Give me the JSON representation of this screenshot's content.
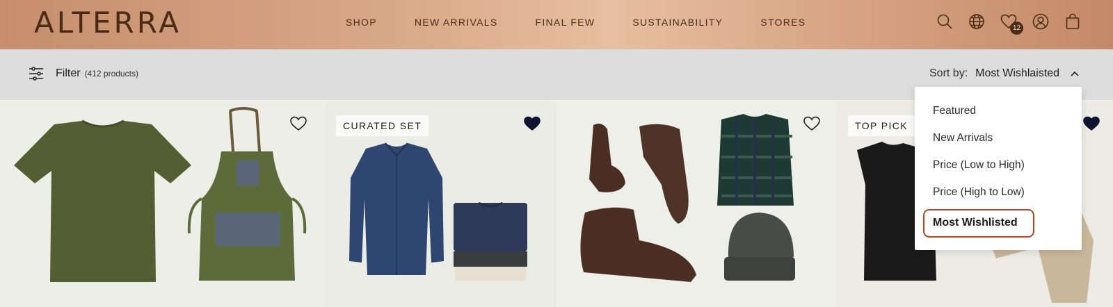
{
  "brand": {
    "logo": "ALTERRA"
  },
  "nav": [
    "SHOP",
    "NEW ARRIVALS",
    "FINAL FEW",
    "SUSTAINABILITY",
    "STORES"
  ],
  "header_icons": {
    "search": "search-icon",
    "region": "globe-icon",
    "wishlist": "heart-icon",
    "wishlist_count": "12",
    "account": "user-icon",
    "bag": "shopping-bag-icon"
  },
  "filterbar": {
    "filter_label": "Filter",
    "product_count": "(412 products)",
    "sort_label": "Sort by:",
    "sort_value": "Most Wishlaisted"
  },
  "sort_options": [
    "Featured",
    "New Arrivals",
    "Price (Low to High)",
    "Price (High to Low)",
    "Most Wishlisted"
  ],
  "products": [
    {
      "tag": "",
      "wishlisted": false,
      "items": "olive t-shirt, olive canvas apron"
    },
    {
      "tag": "CURATED SET",
      "wishlisted": true,
      "items": "denim shirt, folded tees"
    },
    {
      "tag": "",
      "wishlisted": false,
      "items": "chukka boots, plaid shirt, beanie"
    },
    {
      "tag": "TOP PICK",
      "wishlisted": true,
      "items": "black tee, khaki trousers"
    }
  ],
  "colors": {
    "brand_text": "#4a2c16",
    "header_gradient_mid": "#e7bea1",
    "filterbar_bg": "#dcdcdd",
    "selected_outline": "#b6451f",
    "wishlisted_heart": "#0f1530"
  }
}
